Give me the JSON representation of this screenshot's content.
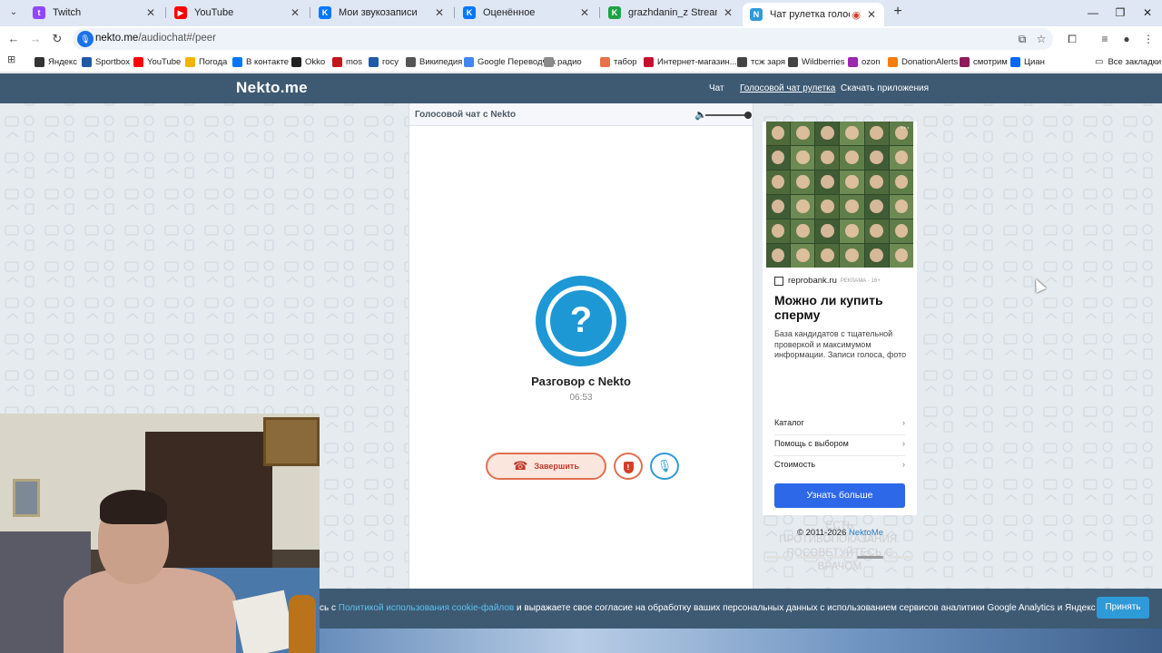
{
  "browser": {
    "tabs": [
      {
        "title": "Twitch",
        "favicon_color": "#9146ff",
        "favicon_glyph": "t"
      },
      {
        "title": "YouTube",
        "favicon_color": "#ff0000",
        "favicon_glyph": "▶"
      },
      {
        "title": "Мои звукозаписи",
        "favicon_color": "#0077ff",
        "favicon_glyph": "K"
      },
      {
        "title": "Оценённое",
        "favicon_color": "#0077ff",
        "favicon_glyph": "K"
      },
      {
        "title": "grazhdanin_z Stream - Watch L",
        "favicon_color": "#1fa244",
        "favicon_glyph": "K"
      },
      {
        "title": "Чат рулетка голосовая — ",
        "favicon_color": "#2f9ad8",
        "favicon_glyph": "N"
      }
    ],
    "url_host": "nekto.me",
    "url_path": "/audiochat#/peer",
    "bookmarks": [
      {
        "label": "Яндекс",
        "color": "#333333"
      },
      {
        "label": "Sportbox",
        "color": "#1e5aa8"
      },
      {
        "label": "YouTube",
        "color": "#ff0000"
      },
      {
        "label": "Погода",
        "color": "#f0b400"
      },
      {
        "label": "В контакте",
        "color": "#0077ff"
      },
      {
        "label": "Okko",
        "color": "#222222"
      },
      {
        "label": "mos",
        "color": "#c4161c"
      },
      {
        "label": "госу",
        "color": "#1e5aa8"
      },
      {
        "label": "Википедия",
        "color": "#555555"
      },
      {
        "label": "Google Переводчик",
        "color": "#4285f4"
      },
      {
        "label": "радио",
        "color": "#8a8a8a"
      },
      {
        "label": "табор",
        "color": "#e8704a"
      },
      {
        "label": "Интернет-магазин...",
        "color": "#c8102e"
      },
      {
        "label": "тсж заря",
        "color": "#444444"
      },
      {
        "label": "Wildberries",
        "color": "#444444"
      },
      {
        "label": "ozon",
        "color": "#9c27b0"
      },
      {
        "label": "DonationAlerts",
        "color": "#f57d07"
      },
      {
        "label": "смотрим",
        "color": "#8e1b5a"
      },
      {
        "label": "Циан",
        "color": "#0468ff"
      }
    ],
    "all_bookmarks": "Все закладки"
  },
  "site": {
    "logo": "Nekto.me",
    "nav": [
      "Чат",
      "Голосовой чат рулетка",
      "Скачать приложения"
    ],
    "accent": "#3e5a73"
  },
  "chat": {
    "header_title": "Голосовой чат с Nekto",
    "peer_name": "Разговор с Nekto",
    "timer": "06:53",
    "end_label": "Завершить",
    "avatar_glyph": "?"
  },
  "ad": {
    "domain": "reprobank.ru",
    "tag": "РЕКЛАМА · 16+",
    "title": "Можно ли купить сперму",
    "description": "База кандидатов с тщательной проверкой и максимумом информации. Записи голоса, фото",
    "links": [
      "Каталог",
      "Помощь с выбором",
      "Стоимость"
    ],
    "cta": "Узнать больше",
    "warning_line1": "ЕСТЬ ПРОТИВОПОКАЗАНИЯ.",
    "warning_line2": "ПОСОВЕТУЙТЕСЬ С ВРАЧОМ"
  },
  "footer": {
    "copyright": "© 2011-2026 ",
    "brand": "NektoMe"
  },
  "cookie": {
    "prefix": "сь с ",
    "link": "Политикой использования cookie-файлов",
    "suffix": " и выражаете свое согласие на обработку ваших персональных данных с использованием сервисов аналитики Google Analytics и Яндекс Метрика.",
    "accept": "Принять"
  }
}
